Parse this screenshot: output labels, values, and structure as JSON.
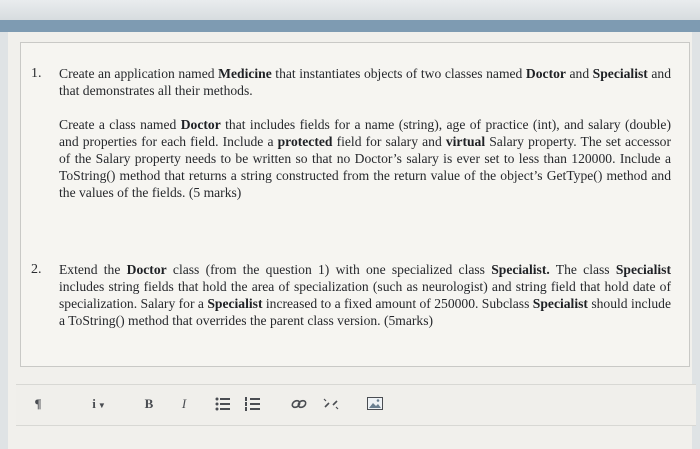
{
  "question1": {
    "number": "1.",
    "intro_1": "Create an application named ",
    "intro_app": "Medicine",
    "intro_2": " that instantiates objects of two classes named ",
    "intro_doctor": "Doctor",
    "intro_3": " and ",
    "intro_specialist": "Specialist",
    "intro_4": " and that demonstrates all their methods.",
    "p2_1": "Create a class named ",
    "p2_doctor": "Doctor",
    "p2_2": " that includes fields for a name (string), age of practice (int), and salary (double) and properties for each field. Include a ",
    "p2_protected": "protected",
    "p2_3": " field for salary and ",
    "p2_virtual": "virtual",
    "p2_4": " Salary property. The set accessor of the Salary property needs to be written so that no Doctor’s salary is ever set to less than 120000. Include a ToString() method that returns a string constructed from the return value of the object’s GetType() method and the values of the fields. (5 marks)"
  },
  "question2": {
    "number": "2.",
    "t1": "Extend the ",
    "doctor": "Doctor",
    "t2": " class (from the question 1) with one specialized class ",
    "specialist1": "Specialist.",
    "t3": " The class ",
    "specialist2": "Specialist",
    "t4": " includes string fields that hold the area of specialization (such as neurologist) and string field that hold date of specialization. Salary for a ",
    "specialist3": "Specialist",
    "t5": " increased to a fixed amount of 250000. Subclass ",
    "specialist4": "Specialist",
    "t6": " should include a ToString() method that overrides the parent class version. (5marks)"
  },
  "toolbar": {
    "paragraph_label": "¶",
    "info_label": "i",
    "bold_label": "B",
    "italic_label": "I",
    "icons": [
      "paragraph-icon",
      "info-icon",
      "bold-icon",
      "italic-icon",
      "bullet-list-icon",
      "numbered-list-icon",
      "link-icon",
      "unlink-icon",
      "image-icon"
    ]
  },
  "colors": {
    "accent_bar": "#7e9bb2",
    "page_bg": "#f1f0ec",
    "text": "#26282c"
  }
}
